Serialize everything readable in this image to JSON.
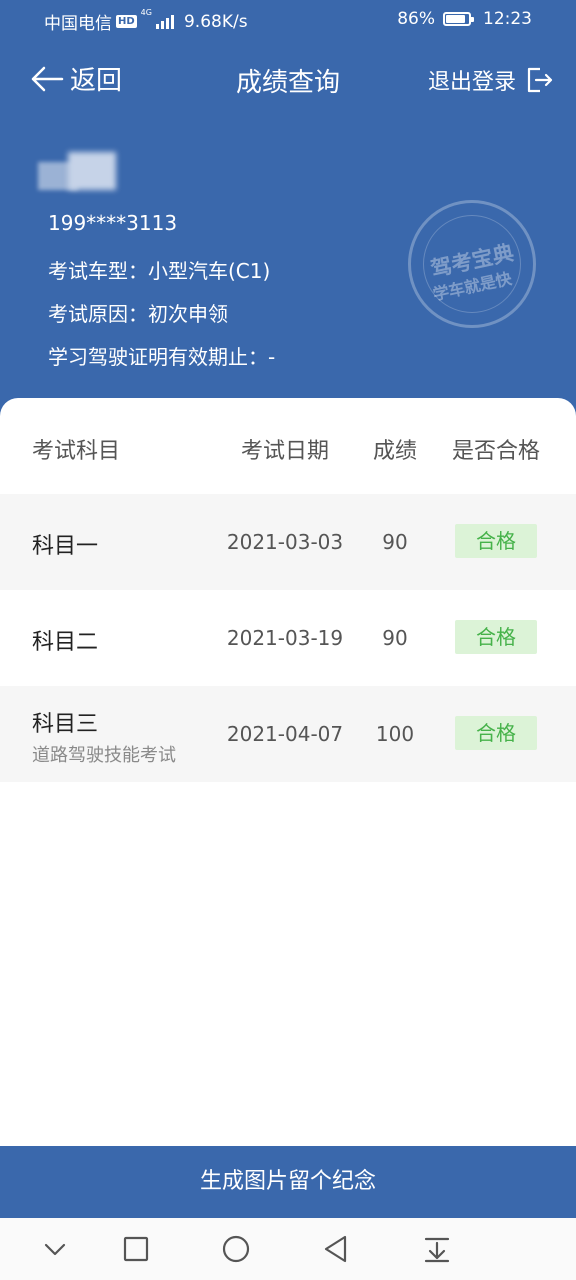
{
  "status_bar": {
    "carrier": "中国电信",
    "hd": "HD",
    "network": "4G",
    "speed": "9.68K/s",
    "battery": "86%",
    "battery_level": 0.86,
    "time": "12:23"
  },
  "header": {
    "back_label": "返回",
    "title": "成绩查询",
    "logout_label": "退出登录"
  },
  "user": {
    "phone": "199****3113",
    "vehicle_type": "考试车型：小型汽车(C1)",
    "exam_reason": "考试原因：初次申领",
    "permit_validity": "学习驾驶证明有效期止：-"
  },
  "stamp": {
    "line1": "驾考宝典",
    "line2": "学车就是快"
  },
  "table": {
    "headers": [
      "考试科目",
      "考试日期",
      "成绩",
      "是否合格"
    ],
    "rows": [
      {
        "subject": "科目一",
        "note": "",
        "date": "2021-03-03",
        "score": "90",
        "status": "合格"
      },
      {
        "subject": "科目二",
        "note": "",
        "date": "2021-03-19",
        "score": "90",
        "status": "合格"
      },
      {
        "subject": "科目三",
        "note": "道路驾驶技能考试",
        "date": "2021-04-07",
        "score": "100",
        "status": "合格"
      }
    ]
  },
  "generate_button": "生成图片留个纪念",
  "colors": {
    "primary": "#3a68ac",
    "pass_bg": "#dcf3d7",
    "pass_text": "#46b24a"
  }
}
